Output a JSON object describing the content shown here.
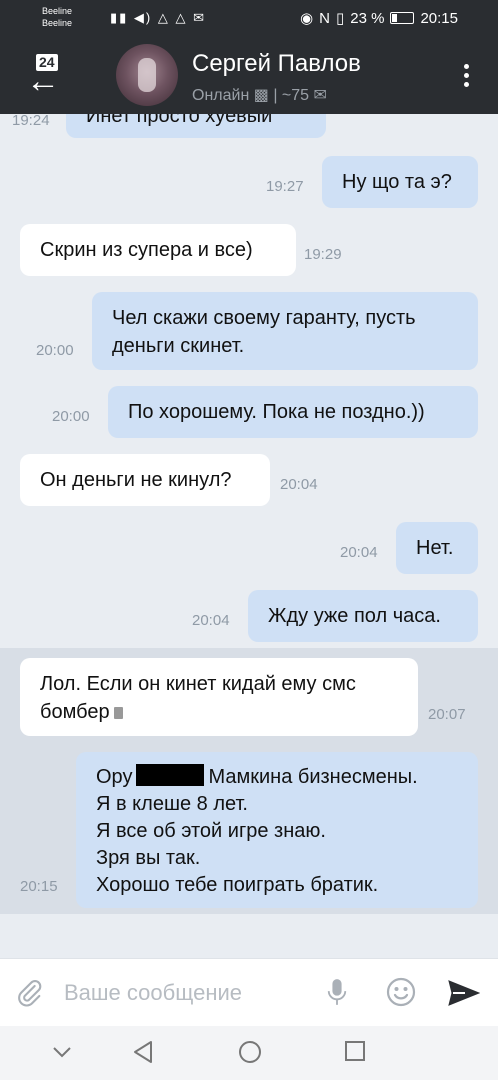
{
  "status_bar": {
    "carrier1": "Beeline",
    "carrier2": "Beeline",
    "battery": "23 %",
    "time": "20:15"
  },
  "header": {
    "back_badge": "24",
    "name": "Сергей Павлов",
    "status": "Онлайн",
    "extra": "| ~75"
  },
  "messages": [
    {
      "dir": "out",
      "text": "Инет просто хуевый",
      "time": "19:24"
    },
    {
      "dir": "out",
      "text": "Ну що та э?",
      "time": "19:27"
    },
    {
      "dir": "in",
      "text": "Скрин из супера и все)",
      "time": "19:29"
    },
    {
      "dir": "out",
      "text_line1": "Чел скажи своему гаранту, пусть",
      "text_line2": "деньги скинет.",
      "time": "20:00"
    },
    {
      "dir": "out",
      "text": "По хорошему. Пока не поздно.))",
      "time": "20:00"
    },
    {
      "dir": "in",
      "text": "Он деньги не кинул?",
      "time": "20:04"
    },
    {
      "dir": "out",
      "text": "Нет.",
      "time": "20:04"
    },
    {
      "dir": "out",
      "text": "Жду уже пол часа.",
      "time": "20:04"
    },
    {
      "dir": "in",
      "text_line1": "Лол. Если он кинет кидай ему смс",
      "text_line2": "бомбер",
      "time": "20:07"
    },
    {
      "dir": "out",
      "line1a": "Ору",
      "line1b": "Мамкина бизнесмены.",
      "line2": "Я в клеше 8 лет.",
      "line3": "Я все об этой игре знаю.",
      "line4": "Зря вы так.",
      "line5": "Хорошо тебе поиграть братик.",
      "time": "20:15"
    }
  ],
  "input": {
    "placeholder": "Ваше сообщение"
  },
  "colors": {
    "header_bg": "#2a2d31",
    "chat_bg": "#e9edf2",
    "bubble_out": "#cfe0f5",
    "bubble_in": "#ffffff",
    "selected_bg": "#d8dee6"
  }
}
